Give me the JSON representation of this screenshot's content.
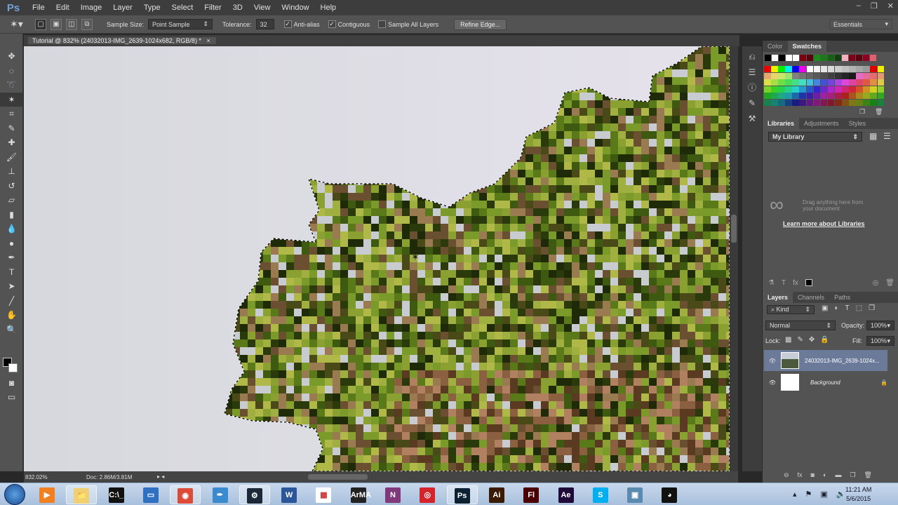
{
  "app": {
    "logo": "Ps",
    "menus": [
      "File",
      "Edit",
      "Image",
      "Layer",
      "Type",
      "Select",
      "Filter",
      "3D",
      "View",
      "Window",
      "Help"
    ],
    "window_controls": [
      "–",
      "❐",
      "✕"
    ]
  },
  "options": {
    "sample_size_label": "Sample Size:",
    "sample_size_value": "Point Sample",
    "tolerance_label": "Tolerance:",
    "tolerance_value": "32",
    "anti_alias": "Anti-alias",
    "anti_alias_checked": true,
    "contiguous": "Contiguous",
    "contiguous_checked": true,
    "sample_all_layers": "Sample All Layers",
    "sample_all_checked": false,
    "refine_edge": "Refine Edge...",
    "workspace": "Essentials"
  },
  "document": {
    "tab_title": "Tutorial @ 832% (24032013-IMG_2639-1024x682, RGB/8) *",
    "close": "×"
  },
  "status": {
    "zoom": "832.02%",
    "doc": "Doc: 2.86M/3.81M"
  },
  "tools": [
    {
      "icon": "move-icon",
      "g": "✥"
    },
    {
      "icon": "marquee-icon",
      "g": "◌"
    },
    {
      "icon": "lasso-icon",
      "g": "➰"
    },
    {
      "icon": "magic-wand-icon",
      "g": "✶"
    },
    {
      "icon": "crop-icon",
      "g": "⌗"
    },
    {
      "icon": "eyedropper-icon",
      "g": "✎"
    },
    {
      "icon": "healing-brush-icon",
      "g": "✚"
    },
    {
      "icon": "brush-icon",
      "g": "🖌"
    },
    {
      "icon": "clone-stamp-icon",
      "g": "⊥"
    },
    {
      "icon": "history-brush-icon",
      "g": "↺"
    },
    {
      "icon": "eraser-icon",
      "g": "▱"
    },
    {
      "icon": "gradient-icon",
      "g": "▮"
    },
    {
      "icon": "blur-icon",
      "g": "💧"
    },
    {
      "icon": "dodge-icon",
      "g": "●"
    },
    {
      "icon": "pen-icon",
      "g": "✒"
    },
    {
      "icon": "type-icon",
      "g": "T"
    },
    {
      "icon": "path-selection-icon",
      "g": "➤"
    },
    {
      "icon": "line-icon",
      "g": "╱"
    },
    {
      "icon": "hand-icon",
      "g": "✋"
    },
    {
      "icon": "zoom-icon",
      "g": "🔍"
    }
  ],
  "swatches": {
    "tabs": [
      "Color",
      "Swatches"
    ],
    "top_row": [
      "#000000",
      "#ffffff",
      "#000000",
      "#ffffff",
      "#ffffff",
      "#7a0010",
      "#5a0010",
      "#1a8a1a",
      "#1a7a1a",
      "#156015",
      "#0f400f",
      "#f0b0c0",
      "#800018",
      "#600010",
      "#900020",
      "#e06070"
    ]
  },
  "libraries": {
    "tabs": [
      "Libraries",
      "Adjustments",
      "Styles"
    ],
    "library": "My Library",
    "drag_text": "Drag anything here from your document",
    "learn_more": "Learn more about Libraries"
  },
  "layers": {
    "tabs": [
      "Layers",
      "Channels",
      "Paths"
    ],
    "filter": "Kind",
    "blend_mode": "Normal",
    "opacity_label": "Opacity:",
    "opacity": "100%",
    "lock_label": "Lock:",
    "fill_label": "Fill:",
    "fill": "100%",
    "items": [
      {
        "name": "24032013-IMG_2639-1024x...",
        "selected": true
      },
      {
        "name": "Background",
        "selected": false
      }
    ]
  },
  "taskbar": {
    "apps": [
      {
        "name": "windows-media-player",
        "g": "▶",
        "bg": "#f08020"
      },
      {
        "name": "file-explorer",
        "g": "📁",
        "bg": "#f0d070"
      },
      {
        "name": "command-prompt",
        "g": "C:\\_",
        "bg": "#111"
      },
      {
        "name": "remote-desktop",
        "g": "▭",
        "bg": "#3070c0"
      },
      {
        "name": "chrome",
        "g": "◉",
        "bg": "#dd4b39"
      },
      {
        "name": "quill-app",
        "g": "✒",
        "bg": "#3a8ad0"
      },
      {
        "name": "steam",
        "g": "⚙",
        "bg": "#1b2838"
      },
      {
        "name": "word",
        "g": "W",
        "bg": "#2b579a"
      },
      {
        "name": "app-grid",
        "g": "▦",
        "bg": "#fff"
      },
      {
        "name": "arma",
        "g": "ArMA",
        "bg": "#222"
      },
      {
        "name": "onenote",
        "g": "N",
        "bg": "#80397b"
      },
      {
        "name": "creative-cloud",
        "g": "◎",
        "bg": "#d4232b"
      },
      {
        "name": "photoshop",
        "g": "Ps",
        "bg": "#0c2234"
      },
      {
        "name": "illustrator",
        "g": "Ai",
        "bg": "#3a1a00"
      },
      {
        "name": "flash",
        "g": "Fl",
        "bg": "#4a0000"
      },
      {
        "name": "after-effects",
        "g": "Ae",
        "bg": "#1f0a3a"
      },
      {
        "name": "skype",
        "g": "S",
        "bg": "#00aff0"
      },
      {
        "name": "photo-viewer",
        "g": "▣",
        "bg": "#5a8ab0"
      },
      {
        "name": "obs",
        "g": "◕",
        "bg": "#111"
      }
    ],
    "time": "11:21 AM",
    "date": "5/6/2015"
  }
}
